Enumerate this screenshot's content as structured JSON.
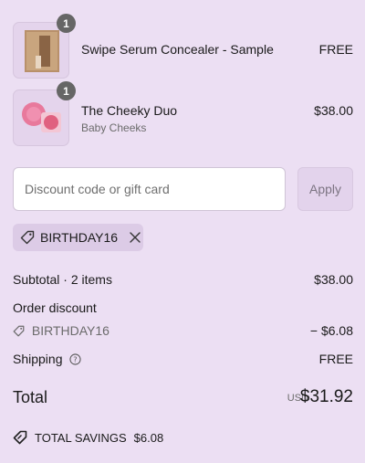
{
  "cart": {
    "items": [
      {
        "name": "Swipe Serum Concealer - Sample",
        "variant": "",
        "price": "FREE",
        "quantity": "1",
        "thumb_icon": "serum-sample-thumbnail"
      },
      {
        "name": "The Cheeky Duo",
        "variant": "Baby Cheeks",
        "price": "$38.00",
        "quantity": "1",
        "thumb_icon": "blush-duo-thumbnail"
      }
    ]
  },
  "discount": {
    "placeholder": "Discount code or gift card",
    "apply_label": "Apply",
    "applied_code": "BIRTHDAY16"
  },
  "summary": {
    "subtotal_label": "Subtotal · 2 items",
    "subtotal_value": "$38.00",
    "order_discount_label": "Order discount",
    "order_discount_code": "BIRTHDAY16",
    "order_discount_value": "− $6.08",
    "shipping_label": "Shipping",
    "shipping_value": "FREE",
    "total_label": "Total",
    "total_currency": "USD",
    "total_value": "$31.92",
    "savings_label": "TOTAL SAVINGS",
    "savings_value": "$6.08"
  },
  "colors": {
    "background": "#ecdff3",
    "chip": "#dccbe6",
    "badge": "#666666"
  }
}
